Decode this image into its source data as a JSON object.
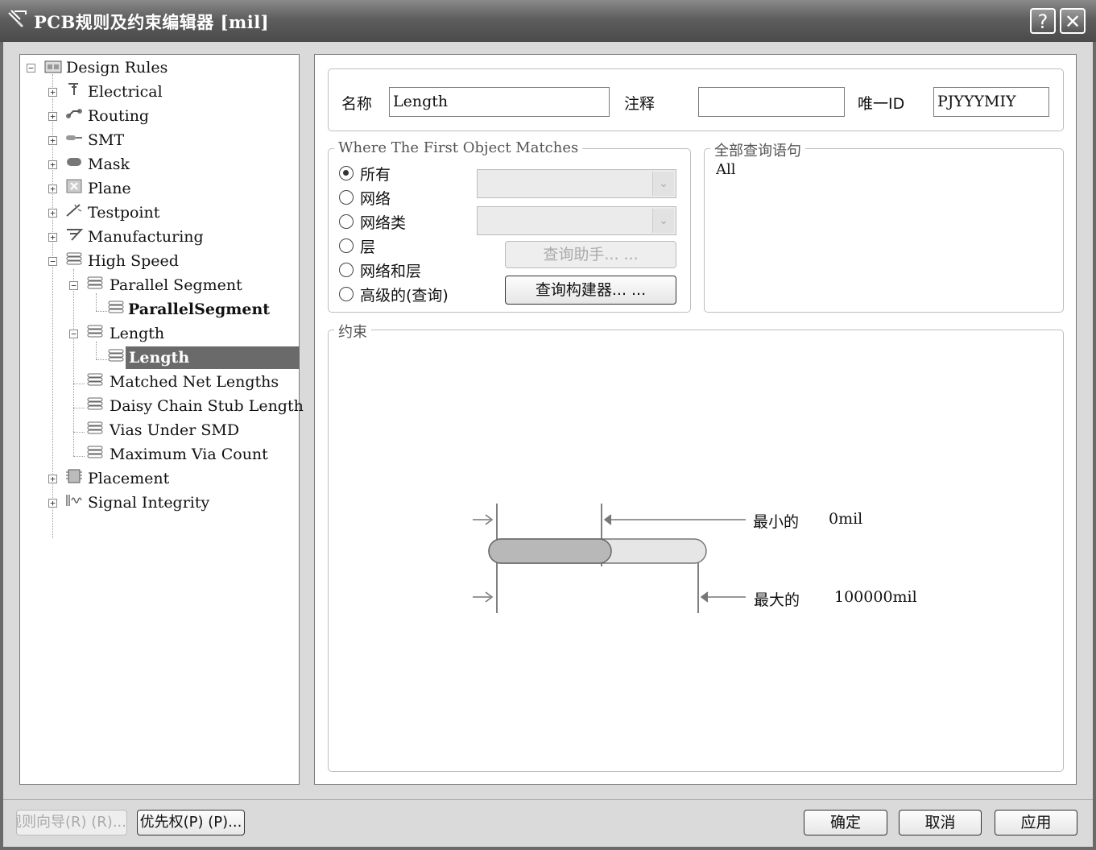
{
  "window": {
    "title": "PCB规则及约束编辑器 [mil]",
    "help_button": "?",
    "close_button": "✕"
  },
  "tree": {
    "root": "Design Rules",
    "categories": [
      {
        "label": "Electrical"
      },
      {
        "label": "Routing"
      },
      {
        "label": "SMT"
      },
      {
        "label": "Mask"
      },
      {
        "label": "Plane"
      },
      {
        "label": "Testpoint"
      },
      {
        "label": "Manufacturing"
      },
      {
        "label": "High Speed"
      }
    ],
    "high_speed_children": [
      {
        "label": "Parallel Segment",
        "rule": "ParallelSegment"
      },
      {
        "label": "Length",
        "rule": "Length"
      },
      {
        "label": "Matched Net Lengths"
      },
      {
        "label": "Daisy Chain Stub Length"
      },
      {
        "label": "Vias Under SMD"
      },
      {
        "label": "Maximum Via Count"
      }
    ],
    "after": [
      {
        "label": "Placement"
      },
      {
        "label": "Signal Integrity"
      }
    ],
    "selected": "Length"
  },
  "rule": {
    "name_label": "名称",
    "name_value": "Length",
    "comment_label": "注释",
    "comment_value": "",
    "uid_label": "唯一ID",
    "uid_value": "PJYYYMIY"
  },
  "match": {
    "legend": "Where The First Object Matches",
    "options": [
      "所有",
      "网络",
      "网络类",
      "层",
      "网络和层",
      "高级的(查询)"
    ],
    "selected": "所有",
    "query_helper": "查询助手... ...",
    "query_builder": "查询构建器... ..."
  },
  "full_query": {
    "legend": "全部查询语句",
    "text": "All"
  },
  "constraints": {
    "legend": "约束",
    "min_label": "最小的",
    "min_value": "0mil",
    "max_label": "最大的",
    "max_value": "100000mil"
  },
  "footer": {
    "wizard_button": "规则向导(R) (R)...",
    "priority_button": "优先权(P) (P)...",
    "ok_button": "确定",
    "cancel_button": "取消",
    "apply_button": "应用"
  }
}
